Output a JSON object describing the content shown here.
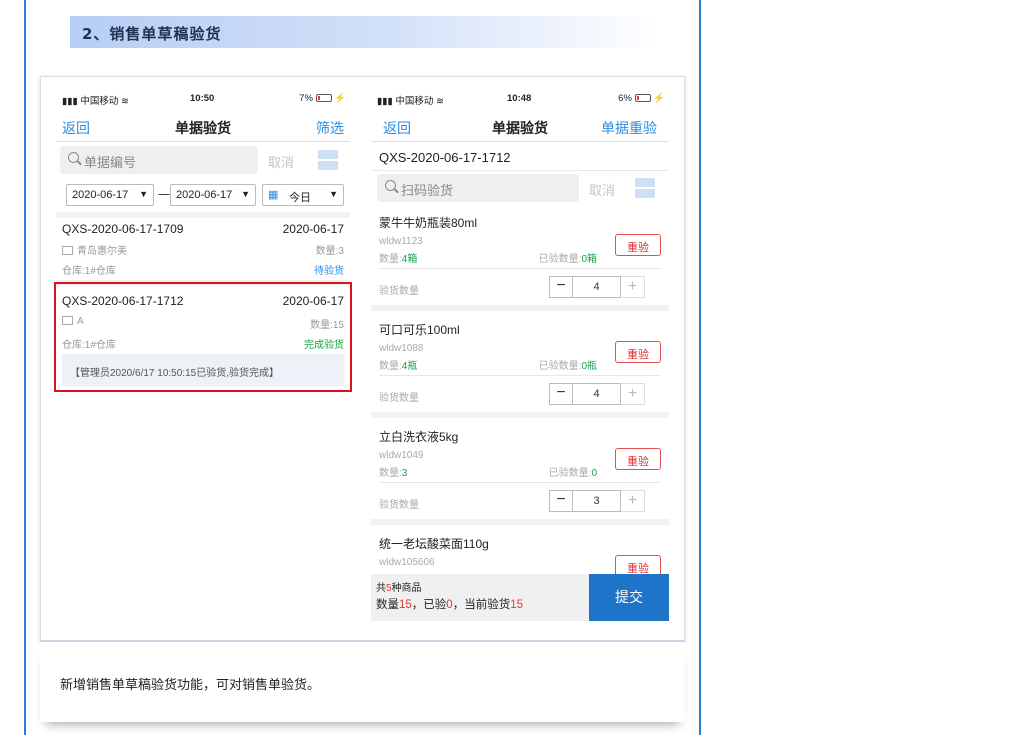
{
  "section": {
    "title": "2、销售单草稿验货"
  },
  "caption": "新增销售单草稿验货功能，可对销售单验货。",
  "colors": {
    "accent": "#2a8de0",
    "highlight": "#d9121b",
    "submit": "#1d74c9",
    "success": "#17a34a"
  },
  "left_phone": {
    "status": {
      "carrier": "中国移动",
      "time": "10:50",
      "battery": "7%"
    },
    "nav": {
      "back": "返回",
      "title": "单据验货",
      "action": "筛选"
    },
    "search": {
      "placeholder": "单据编号",
      "cancel": "取消"
    },
    "filter": {
      "date_from": "2020-06-17",
      "separator": "—",
      "date_to": "2020-06-17",
      "range": "今日"
    },
    "orders": [
      {
        "no": "QXS-2020-06-17-1709",
        "date": "2020-06-17",
        "customer": "青岛惠尔美",
        "qty": "数量:3",
        "warehouse": "仓库:1#仓库",
        "status": "待验货"
      },
      {
        "no": "QXS-2020-06-17-1712",
        "date": "2020-06-17",
        "customer": "A",
        "qty": "数量:15",
        "warehouse": "仓库:1#仓库",
        "status": "完成验货",
        "remark": "【管理员2020/6/17 10:50:15已验货,验货完成】"
      }
    ]
  },
  "right_phone": {
    "status": {
      "carrier": "中国移动",
      "time": "10:48",
      "battery": "6%"
    },
    "nav": {
      "back": "返回",
      "title": "单据验货",
      "action": "单据重验"
    },
    "order_no": "QXS-2020-06-17-1712",
    "search": {
      "placeholder": "扫码验货",
      "cancel": "取消"
    },
    "items": [
      {
        "name": "蒙牛牛奶瓶装80ml",
        "code": "wldw1123",
        "qty_label": "数量:",
        "qty": "4箱",
        "checked_label": "已验数量:",
        "checked": "0箱",
        "recheck": "重验",
        "verify_label": "验货数量",
        "verify_value": "4"
      },
      {
        "name": "可口可乐100ml",
        "code": "wldw1088",
        "qty_label": "数量:",
        "qty": "4瓶",
        "checked_label": "已验数量:",
        "checked": "0瓶",
        "recheck": "重验",
        "verify_label": "验货数量",
        "verify_value": "4"
      },
      {
        "name": "立白洗衣液5kg",
        "code": "wldw1049",
        "qty_label": "数量:",
        "qty": "3",
        "checked_label": "已验数量:",
        "checked": "0",
        "recheck": "重验",
        "verify_label": "验货数量",
        "verify_value": "3"
      },
      {
        "name": "统一老坛酸菜面110g",
        "code": "wldw105606",
        "recheck": "重验"
      }
    ],
    "footer": {
      "l1_prefix": "共",
      "l1_count": "5",
      "l1_suffix": "种商品",
      "qty_label": "数量",
      "qty": "15",
      "checked_label": "，已验",
      "checked": "0",
      "current_label": "，当前验货",
      "current": "15",
      "submit": "提交"
    }
  }
}
